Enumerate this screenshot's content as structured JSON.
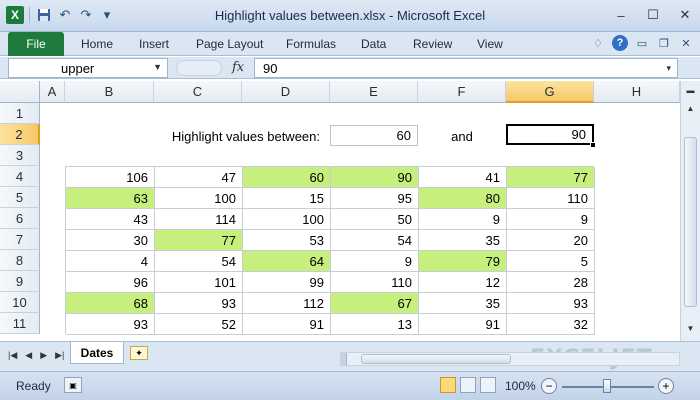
{
  "window": {
    "title": "Highlight values between.xlsx - Microsoft Excel",
    "app_icon": "X",
    "controls": [
      "minimize-icon",
      "maximize-icon",
      "close-icon"
    ]
  },
  "quick_access": {
    "icons": [
      "save-icon",
      "undo-icon",
      "redo-icon",
      "customize-icon"
    ]
  },
  "ribbon": {
    "file_label": "File",
    "tabs": [
      "Home",
      "Insert",
      "Page Layout",
      "Formulas",
      "Data",
      "Review",
      "View"
    ],
    "help_glyph": "?"
  },
  "formula_bar": {
    "name_box": "upper",
    "fx": "fx",
    "value": "90"
  },
  "grid": {
    "columns": [
      "A",
      "B",
      "C",
      "D",
      "E",
      "F",
      "G",
      "H"
    ],
    "rows": [
      "1",
      "2",
      "3",
      "4",
      "5",
      "6",
      "7",
      "8",
      "9",
      "10",
      "11"
    ],
    "active_column": "G",
    "active_row": "2",
    "label": "Highlight values between:",
    "lower_value": "60",
    "and_text": "and",
    "upper_value": "90",
    "highlight_color": "#c6ef7e",
    "table": [
      [
        "106",
        "47",
        "60",
        "90",
        "41",
        "77"
      ],
      [
        "63",
        "100",
        "15",
        "95",
        "80",
        "110"
      ],
      [
        "43",
        "114",
        "100",
        "50",
        "9",
        "9"
      ],
      [
        "30",
        "77",
        "53",
        "54",
        "35",
        "20"
      ],
      [
        "4",
        "54",
        "64",
        "9",
        "79",
        "5"
      ],
      [
        "96",
        "101",
        "99",
        "110",
        "12",
        "28"
      ],
      [
        "68",
        "93",
        "112",
        "67",
        "35",
        "93"
      ],
      [
        "93",
        "52",
        "91",
        "13",
        "91",
        "32"
      ]
    ]
  },
  "sheets": {
    "active": "Dates",
    "watermark": "EXCELJET"
  },
  "status": {
    "text": "Ready",
    "zoom": "100%",
    "zoom_out": "−",
    "zoom_in": "+"
  }
}
